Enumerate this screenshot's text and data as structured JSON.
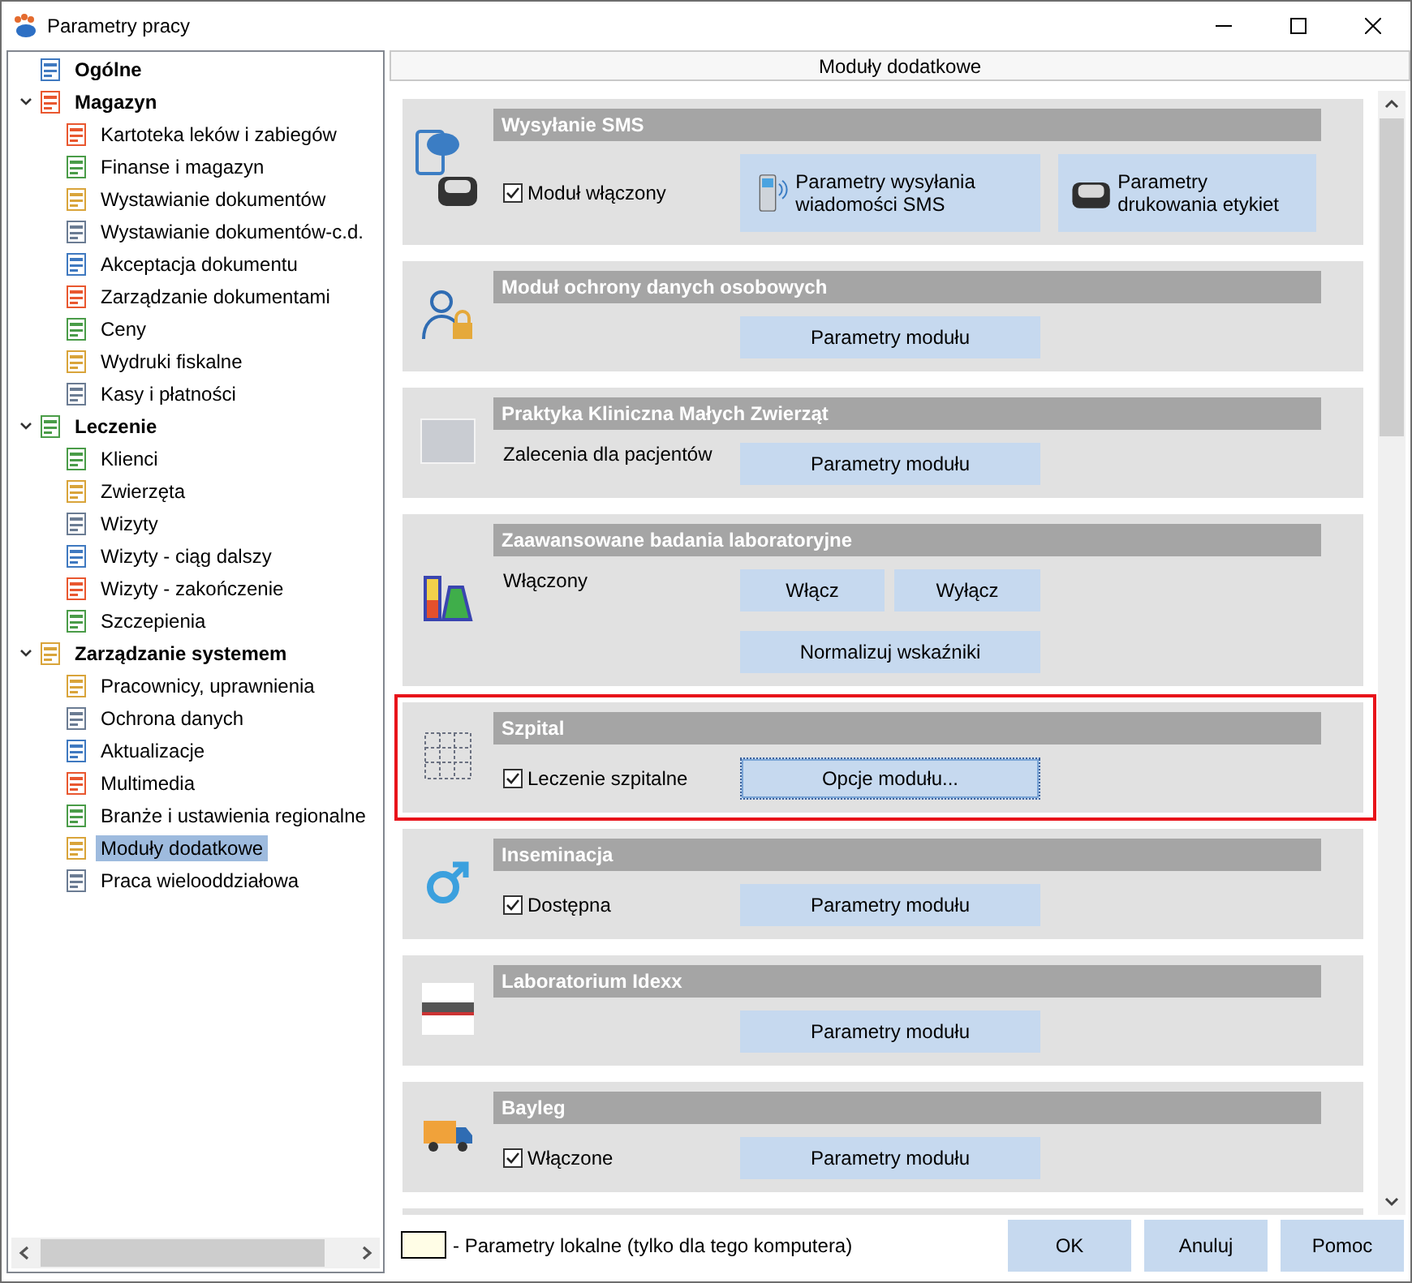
{
  "window": {
    "title": "Parametry pracy"
  },
  "tree": [
    {
      "label": "Ogólne",
      "selected": false
    },
    {
      "label": "Magazyn",
      "expanded": true,
      "selected": false,
      "children": [
        {
          "label": "Kartoteka leków i zabiegów",
          "selected": false
        },
        {
          "label": "Finanse i magazyn",
          "selected": false
        },
        {
          "label": "Wystawianie dokumentów",
          "selected": false
        },
        {
          "label": "Wystawianie dokumentów-c.d.",
          "selected": false
        },
        {
          "label": "Akceptacja dokumentu",
          "selected": false
        },
        {
          "label": "Zarządzanie dokumentami",
          "selected": false
        },
        {
          "label": "Ceny",
          "selected": false
        },
        {
          "label": "Wydruki fiskalne",
          "selected": false
        },
        {
          "label": "Kasy i płatności",
          "selected": false
        }
      ]
    },
    {
      "label": "Leczenie",
      "expanded": true,
      "selected": false,
      "children": [
        {
          "label": "Klienci",
          "selected": false
        },
        {
          "label": "Zwierzęta",
          "selected": false
        },
        {
          "label": "Wizyty",
          "selected": false
        },
        {
          "label": "Wizyty - ciąg dalszy",
          "selected": false
        },
        {
          "label": "Wizyty - zakończenie",
          "selected": false
        },
        {
          "label": "Szczepienia",
          "selected": false
        }
      ]
    },
    {
      "label": "Zarządzanie systemem",
      "expanded": true,
      "selected": false,
      "children": [
        {
          "label": "Pracownicy, uprawnienia",
          "selected": false
        },
        {
          "label": "Ochrona danych",
          "selected": false
        },
        {
          "label": "Aktualizacje",
          "selected": false
        },
        {
          "label": "Multimedia",
          "selected": false
        },
        {
          "label": "Branże i ustawienia regionalne",
          "selected": false
        },
        {
          "label": "Moduły dodatkowe",
          "selected": true
        },
        {
          "label": "Praca wielooddziałowa",
          "selected": false
        }
      ]
    }
  ],
  "panel": {
    "title": "Moduły dodatkowe"
  },
  "modules": [
    {
      "title": "Wysyłanie SMS",
      "highlighted": false,
      "option": {
        "kind": "checkbox",
        "label": "Moduł włączony",
        "checked": true
      },
      "buttons": [
        {
          "kind": "large",
          "label": "Parametry wysyłania wiadomości SMS",
          "focused": false
        },
        {
          "kind": "large",
          "label": "Parametry drukowania etykiet",
          "focused": false
        }
      ]
    },
    {
      "title": "Moduł ochrony danych osobowych",
      "highlighted": false,
      "buttons": [
        {
          "kind": "full",
          "label": "Parametry modułu",
          "focused": false
        }
      ]
    },
    {
      "title": "Praktyka Kliniczna Małych Zwierząt",
      "highlighted": false,
      "option": {
        "kind": "text",
        "label": "Zalecenia dla pacjentów"
      },
      "buttons": [
        {
          "kind": "full",
          "label": "Parametry modułu",
          "focused": false
        }
      ]
    },
    {
      "title": "Zaawansowane badania laboratoryjne",
      "highlighted": false,
      "option": {
        "kind": "text",
        "label": "Włączony"
      },
      "buttons": [
        {
          "kind": "half",
          "label": "Włącz",
          "focused": false
        },
        {
          "kind": "half",
          "label": "Wyłącz",
          "focused": false
        },
        {
          "kind": "full",
          "label": "Normalizuj wskaźniki",
          "focused": false
        }
      ]
    },
    {
      "title": "Szpital",
      "highlighted": true,
      "option": {
        "kind": "checkbox",
        "label": "Leczenie szpitalne",
        "checked": true
      },
      "buttons": [
        {
          "kind": "full",
          "label": "Opcje modułu...",
          "focused": true
        }
      ]
    },
    {
      "title": "Inseminacja",
      "highlighted": false,
      "option": {
        "kind": "checkbox",
        "label": "Dostępna",
        "checked": true
      },
      "buttons": [
        {
          "kind": "full",
          "label": "Parametry modułu",
          "focused": false
        }
      ]
    },
    {
      "title": "Laboratorium Idexx",
      "highlighted": false,
      "buttons": [
        {
          "kind": "full",
          "label": "Parametry modułu",
          "focused": false
        }
      ]
    },
    {
      "title": "Bayleg",
      "highlighted": false,
      "option": {
        "kind": "checkbox",
        "label": "Włączone",
        "checked": true
      },
      "buttons": [
        {
          "kind": "full",
          "label": "Parametry modułu",
          "focused": false
        }
      ]
    }
  ],
  "legend": {
    "label": "- Parametry lokalne (tylko dla tego komputera)"
  },
  "buttons": [
    {
      "label": "OK"
    },
    {
      "label": "Anuluj"
    },
    {
      "label": "Pomoc"
    }
  ]
}
